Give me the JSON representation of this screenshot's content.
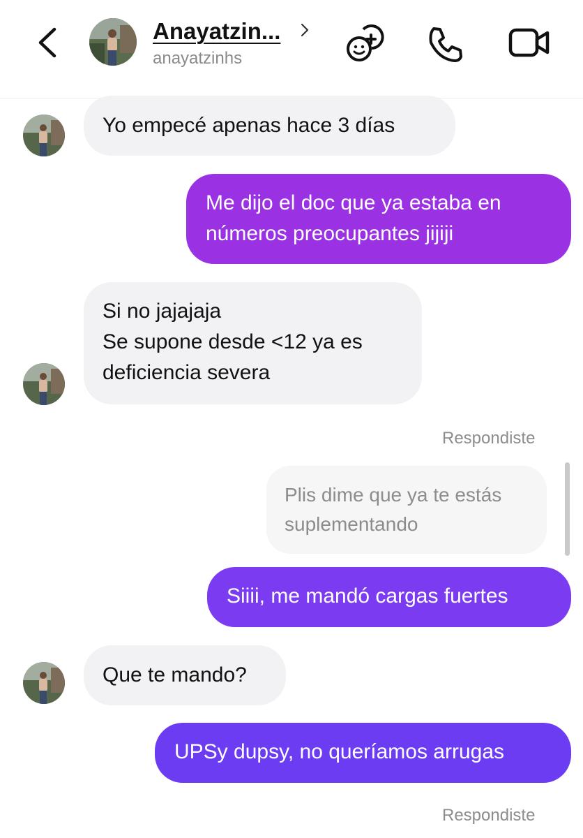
{
  "header": {
    "back_icon": "chevron-left-icon",
    "contact_name": "Anayatzin...",
    "contact_handle": "anayatzinhs",
    "icons": [
      "effects-icon",
      "phone-icon",
      "video-camera-icon"
    ]
  },
  "colors": {
    "bubble_out_1": "#9a32e3",
    "bubble_out_2": "#7b3bf0",
    "bubble_out_3": "#6c3cf3",
    "bubble_in": "#f2f2f4"
  },
  "messages": [
    {
      "from": "them",
      "text": "Yo empecé apenas hace 3 días"
    },
    {
      "from": "me",
      "text": "Me dijo el doc que ya estaba en\nnúmeros preocupantes jijiji"
    },
    {
      "from": "them",
      "text": "Si no jajajaja\nSe supone desde <12 ya es\ndeficiencia severa"
    },
    {
      "from": "label",
      "text": "Respondiste"
    },
    {
      "from": "me-reply-preview",
      "text": "Plis dime que ya te estás\nsuplementando"
    },
    {
      "from": "me",
      "text": "Siiii, me mandó cargas fuertes"
    },
    {
      "from": "them",
      "text": "Que te mando?"
    },
    {
      "from": "me",
      "text": "UPSy dupsy, no queríamos arrugas"
    },
    {
      "from": "label",
      "text": "Respondiste"
    }
  ]
}
